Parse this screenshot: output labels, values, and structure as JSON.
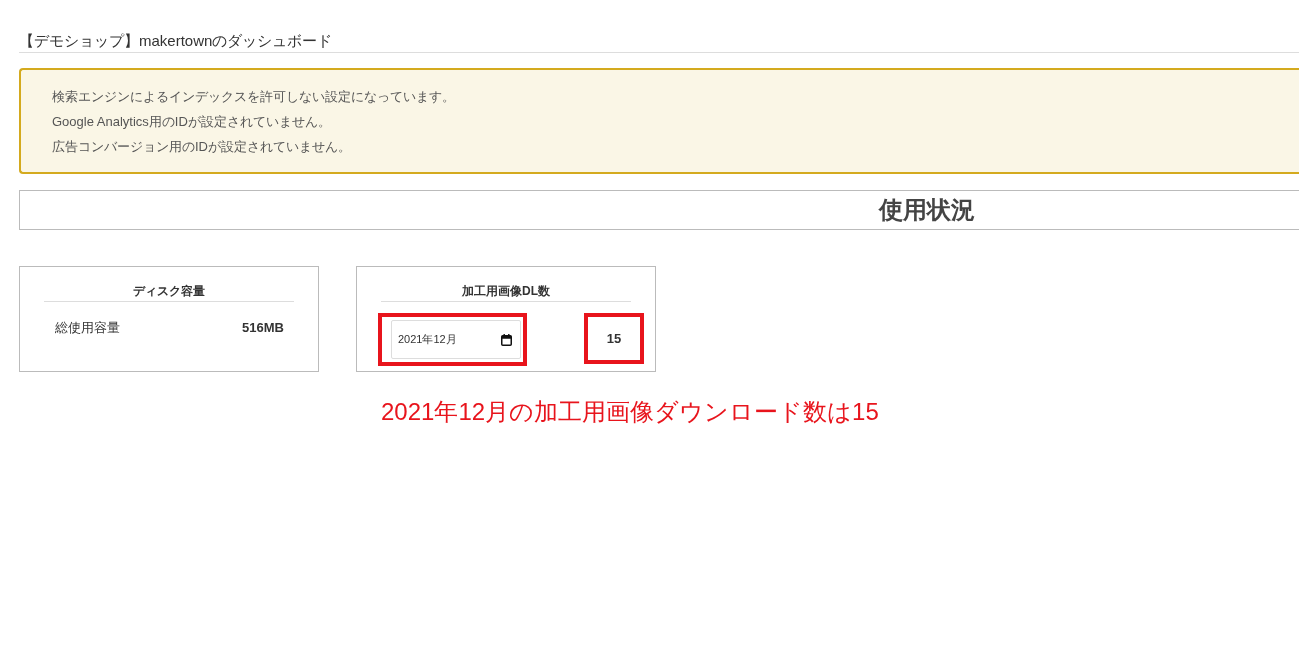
{
  "page_title": "【デモショップ】makertownのダッシュボード",
  "alert": {
    "messages": [
      "検索エンジンによるインデックスを許可しない設定になっています。",
      "Google Analytics用のIDが設定されていません。",
      "広告コンバージョン用のIDが設定されていません。"
    ]
  },
  "usage": {
    "title": "使用状況",
    "cards": [
      {
        "kind": "disk",
        "title": "ディスク容量",
        "label": "総使用容量",
        "value": "516MB",
        "highlighted": false
      },
      {
        "kind": "downloads",
        "title": "加工用画像DL数",
        "month": "2021年12月",
        "value": "15",
        "highlighted": true
      }
    ]
  },
  "annotation": {
    "caption": "2021年12月の加工用画像ダウンロード数は15"
  }
}
